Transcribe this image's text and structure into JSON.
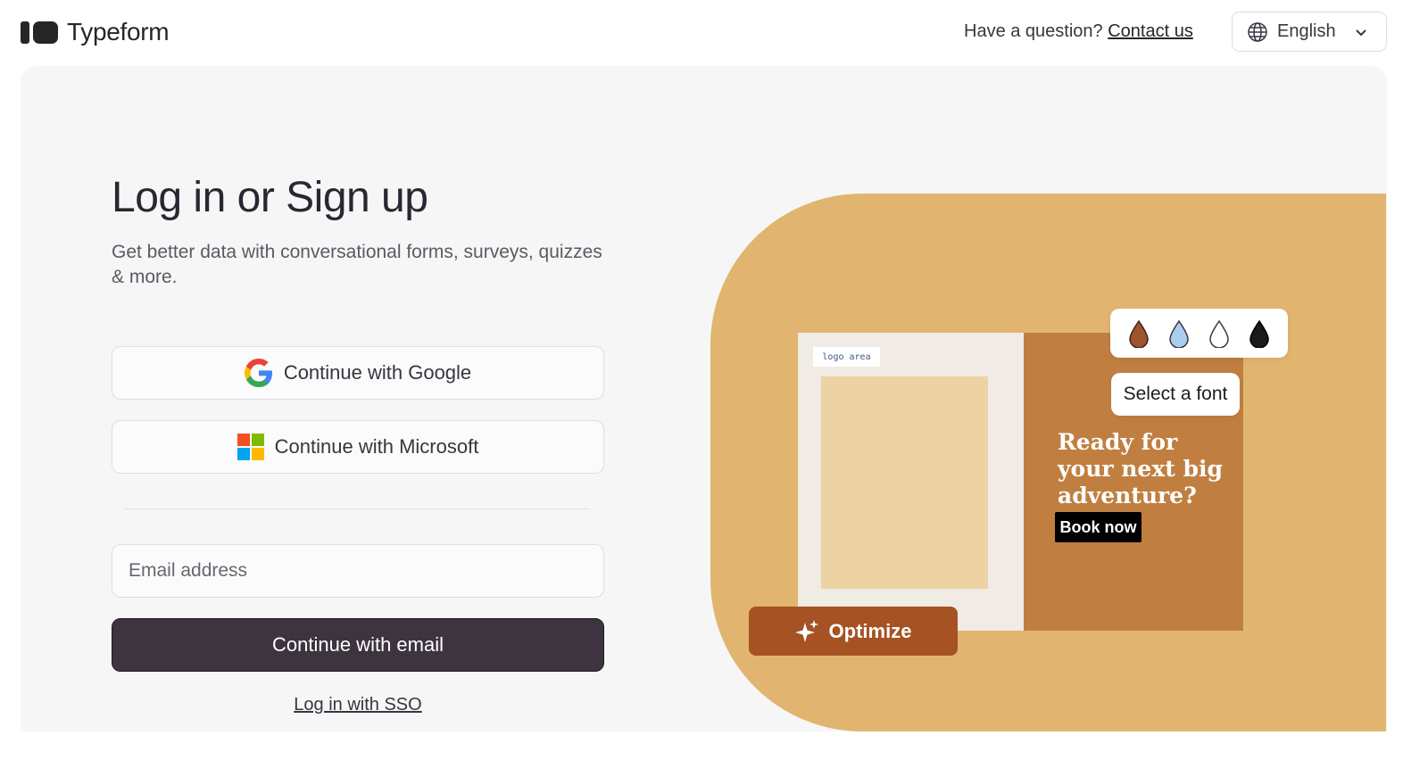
{
  "brand": {
    "name": "Typeform"
  },
  "header": {
    "question_text": "Have a question?",
    "contact_link": "Contact us",
    "language": "English"
  },
  "main": {
    "title": "Log in or Sign up",
    "subtitle": "Get better data with conversational forms, surveys, quizzes & more.",
    "google_button": "Continue with Google",
    "microsoft_button": "Continue with Microsoft",
    "email_placeholder": "Email address",
    "email_value": "",
    "email_button": "Continue with email",
    "sso_link": "Log in with SSO"
  },
  "illustration": {
    "logo_area": "logo area",
    "headline": "Ready for your next big adventure?",
    "cta": "Book now",
    "font_chip": "Select a font",
    "optimize_button": "Optimize",
    "drop_colors": [
      "#a0522d",
      "#a9cfee",
      "#ffffff",
      "#1a1a1a"
    ]
  },
  "colors": {
    "primary_button": "#3d3440",
    "illustration_bg": "#e1b56f",
    "card_accent": "#c07f40",
    "optimize": "#a65223"
  },
  "icons": [
    "typeform-logo-icon",
    "globe-icon",
    "chevron-down-icon",
    "google-icon",
    "microsoft-icon",
    "drop-icon",
    "sparkle-icon"
  ]
}
